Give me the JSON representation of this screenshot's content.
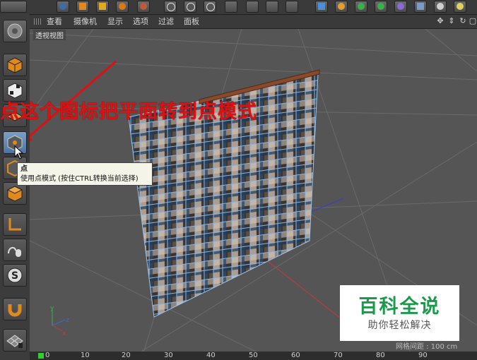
{
  "menu": {
    "items": [
      "查看",
      "摄像机",
      "显示",
      "选项",
      "过滤",
      "面板"
    ]
  },
  "viewport": {
    "label": "透视视图",
    "status": "网格间距 : 100 cm"
  },
  "annotation": {
    "text": "点这个图标把平面转到点模式",
    "color": "#dd1111"
  },
  "tooltip": {
    "title": "点",
    "description": "使用点模式 (按住CTRL转换当前选择)"
  },
  "watermark": {
    "title": "百科全说",
    "subtitle": "助你轻松解决",
    "color": "#1a9a4a"
  },
  "timeline": {
    "ticks": [
      "0",
      "10",
      "20",
      "30",
      "40",
      "50",
      "60",
      "70",
      "80",
      "90"
    ]
  },
  "icons": {
    "left_toolbar": [
      "cinema4d-logo-icon",
      "model-mode-icon",
      "texture-mode-icon",
      "point-mode-icon",
      "edge-mode-icon",
      "polygon-mode-icon",
      "axis-icon",
      "tweak-icon",
      "snap-icon",
      "magnet-icon",
      "workplane-icon"
    ]
  }
}
